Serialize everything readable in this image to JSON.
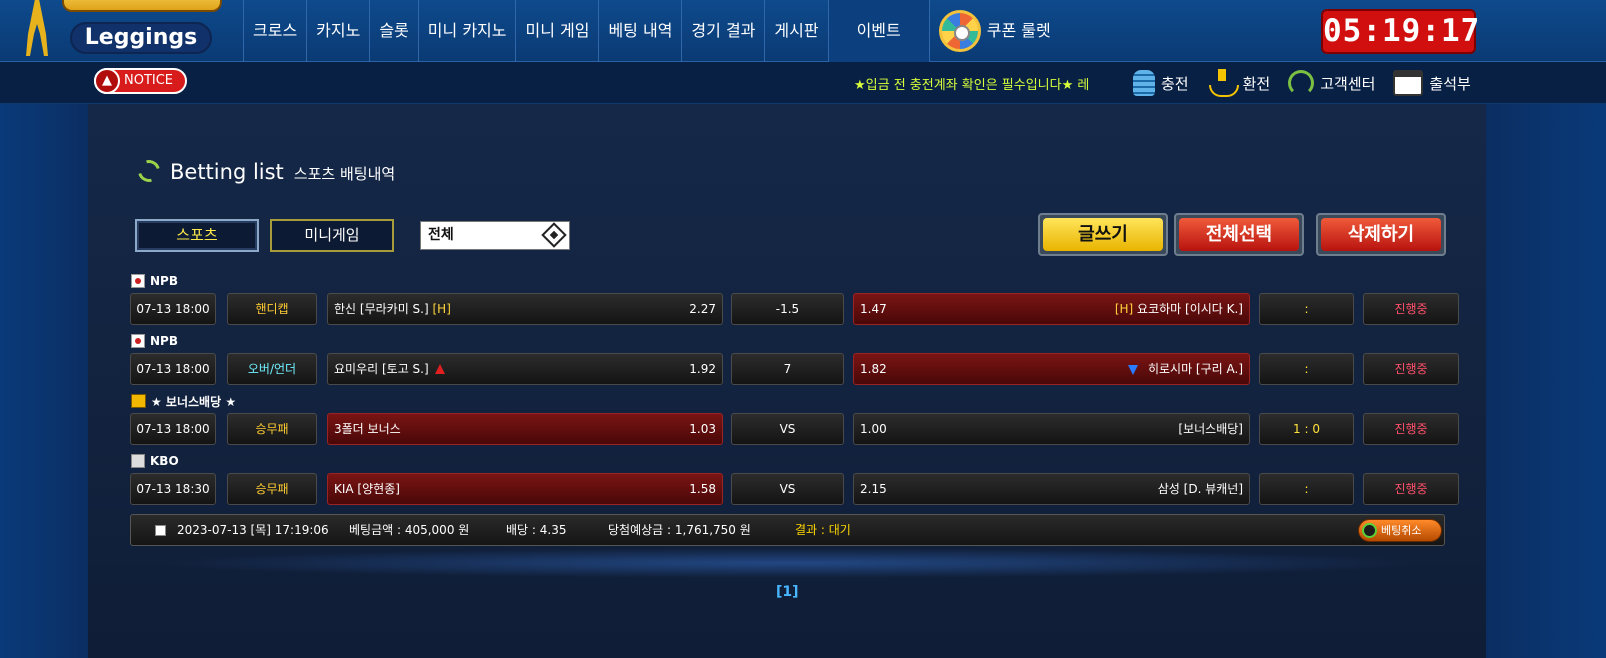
{
  "brand": {
    "logo_text": "Leggings"
  },
  "nav": {
    "items": [
      "크로스",
      "카지노",
      "슬롯",
      "미니 카지노",
      "미니 게임",
      "베팅 내역",
      "경기 결과",
      "게시판"
    ],
    "event": "이벤트",
    "roulette": "쿠폰 룰렛"
  },
  "clock": "05:19:17",
  "notice": {
    "label": "NOTICE",
    "marquee": "★입금 전 충전계좌 확인은 필수입니다★ 레"
  },
  "sub_links": {
    "charge": "충전",
    "exchange": "환전",
    "support": "고객센터",
    "attendance": "출석부"
  },
  "page": {
    "title_en": "Betting list",
    "title_ko": "스포츠 배팅내역"
  },
  "tabs": {
    "sports": "스포츠",
    "minigame": "미니게임"
  },
  "filter": {
    "selected": "전체"
  },
  "actions": {
    "write": "글쓰기",
    "select_all": "전체선택",
    "delete": "삭제하기"
  },
  "bets": [
    {
      "league": "NPB",
      "time": "07-13 18:00",
      "type": "핸디캡",
      "home": "한신 [무라카미 S.]",
      "home_mark": "[H]",
      "home_odd": "2.27",
      "mid": "-1.5",
      "away_odd": "1.47",
      "away_mark": "[H]",
      "away": "요코하마 [이시다 K.]",
      "score": ":",
      "status": "진행중",
      "picked": "away"
    },
    {
      "league": "NPB",
      "time": "07-13 18:00",
      "type": "오버/언더",
      "home": "요미우리 [토고 S.]",
      "home_odd": "1.92",
      "mid": "7",
      "away_odd": "1.82",
      "away": "히로시마 [구리 A.]",
      "score": ":",
      "status": "진행중",
      "picked": "away"
    },
    {
      "league": "★ 보너스배당 ★",
      "time": "07-13 18:00",
      "type": "승무패",
      "home": "3폴더 보너스",
      "home_odd": "1.03",
      "mid": "VS",
      "away_odd": "1.00",
      "away": "[보너스배당]",
      "score": "1 : 0",
      "status": "진행중",
      "picked": "home"
    },
    {
      "league": "KBO",
      "time": "07-13 18:30",
      "type": "승무패",
      "home": "KIA [양현종]",
      "home_odd": "1.58",
      "mid": "VS",
      "away_odd": "2.15",
      "away": "삼성 [D. 뷰캐넌]",
      "score": ":",
      "status": "진행중",
      "picked": "home"
    }
  ],
  "summary": {
    "datetime": "2023-07-13 [목] 17:19:06",
    "amount": "베팅금액 : 405,000 원",
    "odds": "배당 : 4.35",
    "expected": "당첨예상금 : 1,761,750 원",
    "result": "결과 : 대기",
    "cancel": "베팅취소"
  },
  "pagination": "[1]"
}
